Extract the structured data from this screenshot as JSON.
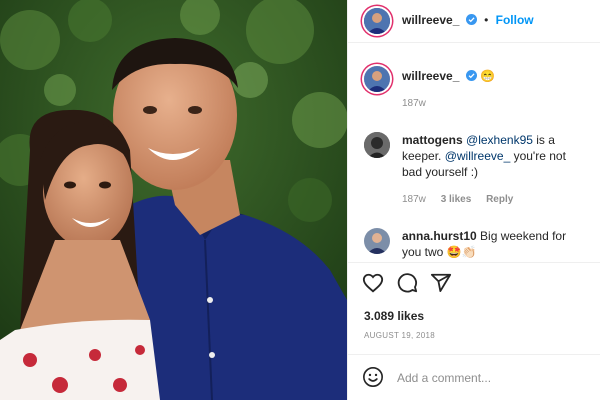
{
  "header": {
    "username": "willreeve_",
    "separator": "•",
    "follow_label": "Follow"
  },
  "caption": {
    "username": "willreeve_",
    "emoji": "😁",
    "age": "187w"
  },
  "comments": [
    {
      "username": "mattogens",
      "mention1": "@lexhenk95",
      "text1": " is a keeper. ",
      "mention2": "@willreeve_",
      "text2": " you're not bad yourself :)",
      "age": "187w",
      "likes": "3 likes",
      "reply_label": "Reply"
    },
    {
      "username": "anna.hurst10",
      "text": " Big weekend for you two 🤩👏🏻"
    }
  ],
  "actions": {
    "like_icon": "heart-icon",
    "comment_icon": "comment-icon",
    "share_icon": "share-icon"
  },
  "likes_count": "3.089 likes",
  "post_date": "AUGUST 19, 2018",
  "composer": {
    "emoji_icon": "smiley-icon",
    "placeholder": "Add a comment..."
  },
  "colors": {
    "link": "#0095f6",
    "mention": "#00376b",
    "muted": "#8e8e8e"
  }
}
